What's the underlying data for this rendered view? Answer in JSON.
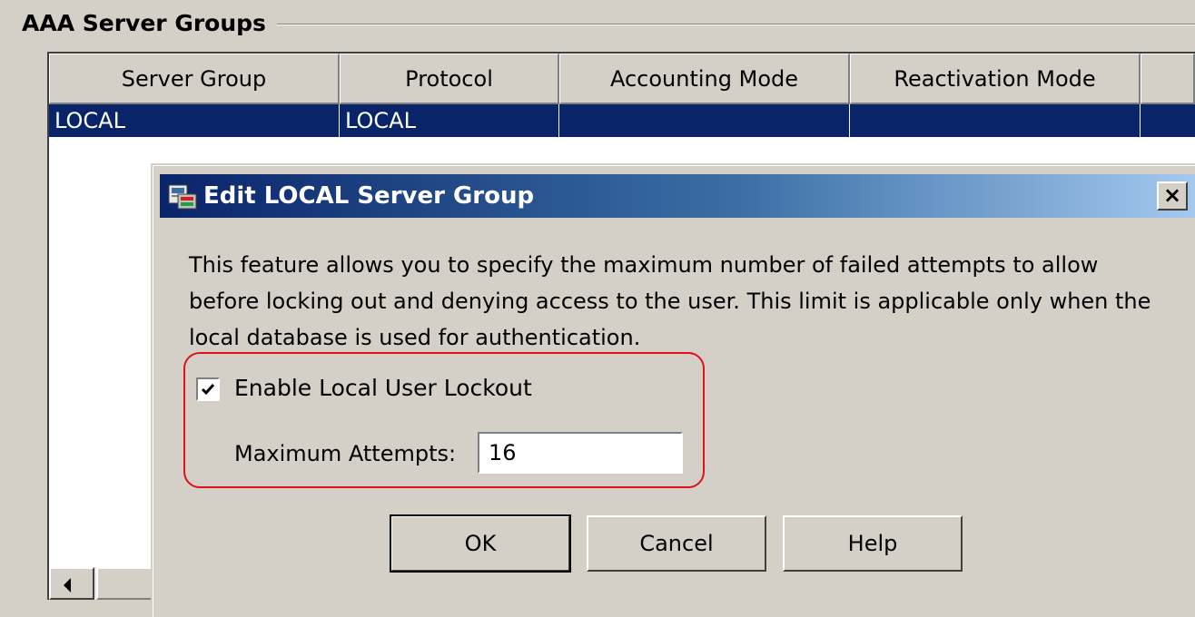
{
  "group": {
    "title": "AAA Server Groups"
  },
  "table": {
    "columns": [
      "Server Group",
      "Protocol",
      "Accounting Mode",
      "Reactivation Mode",
      ""
    ],
    "rows": [
      {
        "server_group": "LOCAL",
        "protocol": "LOCAL",
        "accounting_mode": "",
        "reactivation_mode": "",
        "extra": ""
      }
    ]
  },
  "dialog": {
    "title": "Edit LOCAL Server Group",
    "close_label": "×",
    "description": "This feature allows you to specify the maximum number of failed attempts to allow before locking out and denying access to the user. This limit is applicable only when the local database is used for authentication.",
    "lockout_checkbox": {
      "label": "Enable Local User Lockout",
      "checked": true
    },
    "max_attempts": {
      "label": "Maximum Attempts:",
      "value": "16"
    },
    "buttons": {
      "ok": "OK",
      "cancel": "Cancel",
      "help": "Help"
    }
  },
  "colors": {
    "selection": "#0a246a",
    "highlight_border": "#e0101a",
    "window_bg": "#d4d0c8"
  }
}
